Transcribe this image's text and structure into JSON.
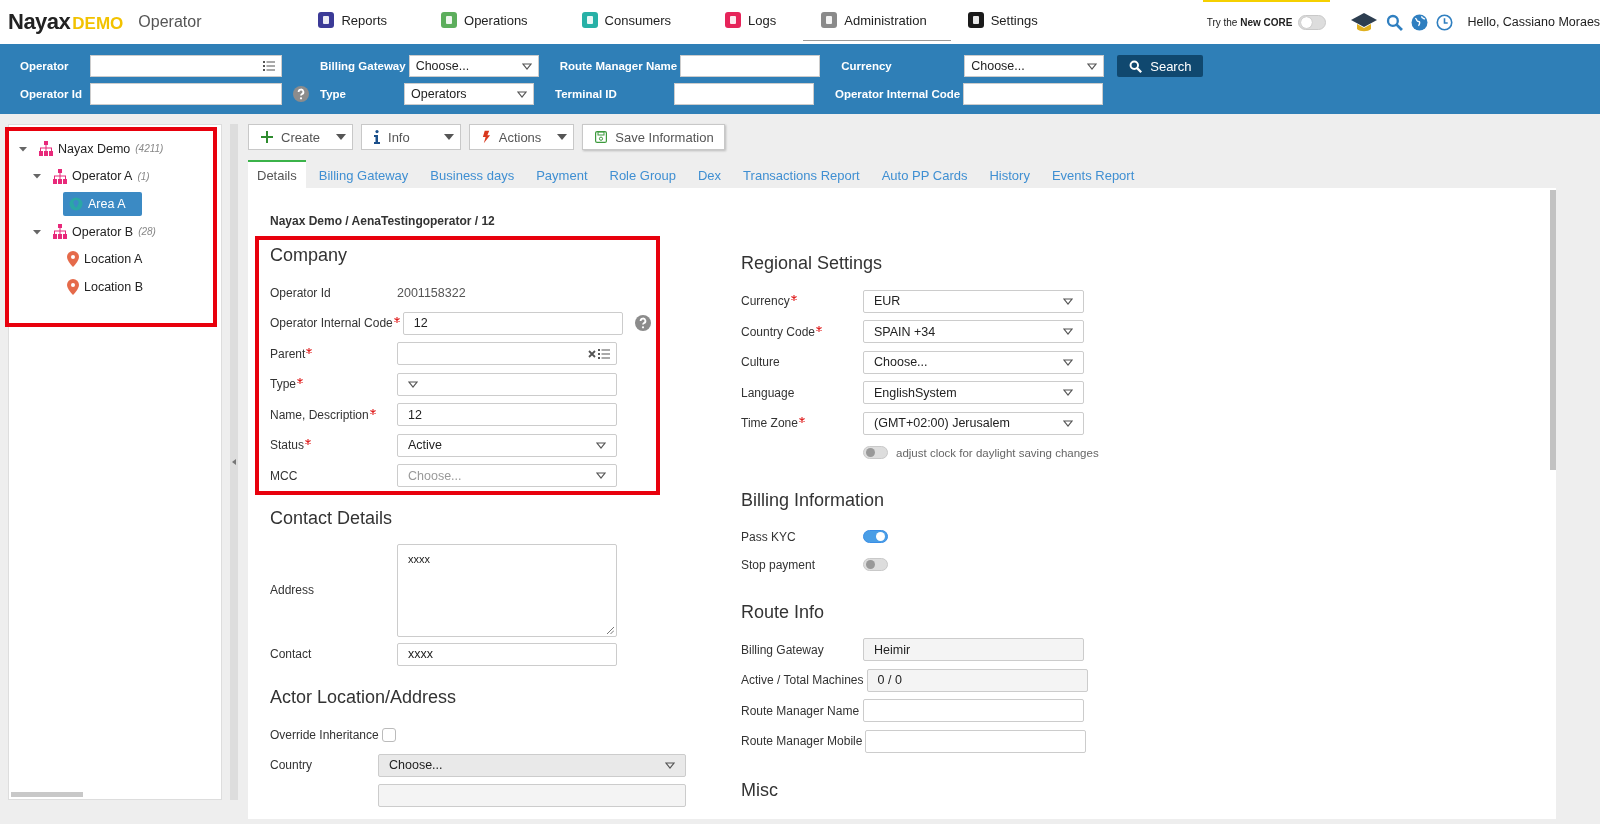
{
  "header": {
    "logo": {
      "name": "Nayax",
      "edition": "DEMO"
    },
    "page_title": "Operator",
    "nav": [
      {
        "label": "Reports",
        "selected": false
      },
      {
        "label": "Operations",
        "selected": false
      },
      {
        "label": "Consumers",
        "selected": false
      },
      {
        "label": "Logs",
        "selected": false
      },
      {
        "label": "Administration",
        "selected": true
      },
      {
        "label": "Settings",
        "selected": false
      }
    ],
    "core_switch": {
      "label": "Try the **New CORE**",
      "on": false
    },
    "greeting": "Hello, Cassiano Moraes"
  },
  "filters": {
    "rows": [
      [
        {
          "label": "Operator",
          "kind": "list",
          "help": false
        },
        {
          "label": "Billing Gateway",
          "kind": "select",
          "value": "Choose...",
          "help": false
        },
        {
          "label": "Route Manager Name",
          "kind": "text",
          "help": false
        },
        {
          "label": "Currency",
          "kind": "select",
          "value": "Choose...",
          "help": false
        }
      ],
      [
        {
          "label": "Operator Id",
          "kind": "text",
          "help": true
        },
        {
          "label": "Type",
          "kind": "select",
          "value": "Operators",
          "help": false
        },
        {
          "label": "Terminal ID",
          "kind": "text",
          "help": false
        },
        {
          "label": "Operator Internal Code",
          "kind": "text",
          "help": false
        }
      ]
    ],
    "search_button": "Search"
  },
  "tree": {
    "highlighted": true,
    "nodes": [
      {
        "label": "Nayax Demo",
        "count": "(4211)",
        "kind": "operator",
        "expanded": true,
        "selected": false,
        "children": [
          {
            "label": "Operator A",
            "count": "(1)",
            "kind": "operator",
            "expanded": true,
            "selected": false,
            "children": [
              {
                "label": "Area A",
                "kind": "area",
                "selected": true
              }
            ]
          },
          {
            "label": "Operator B",
            "count": "(28)",
            "kind": "operator",
            "expanded": true,
            "selected": false,
            "children": [
              {
                "label": "Location A",
                "kind": "location",
                "selected": false
              },
              {
                "label": "Location B",
                "kind": "location",
                "selected": false
              }
            ]
          }
        ]
      }
    ]
  },
  "toolbar": [
    {
      "label": "Create",
      "dropdown": true
    },
    {
      "label": "Info",
      "dropdown": true
    },
    {
      "label": "Actions",
      "dropdown": true
    },
    {
      "label": "Save Information",
      "dropdown": false
    }
  ],
  "tabs": [
    {
      "label": "Details",
      "selected": true
    },
    {
      "label": "Billing Gateway",
      "selected": false
    },
    {
      "label": "Business days",
      "selected": false
    },
    {
      "label": "Payment",
      "selected": false
    },
    {
      "label": "Role Group",
      "selected": false
    },
    {
      "label": "Dex",
      "selected": false
    },
    {
      "label": "Transactions Report",
      "selected": false
    },
    {
      "label": "Auto PP Cards",
      "selected": false
    },
    {
      "label": "History",
      "selected": false
    },
    {
      "label": "Events Report",
      "selected": false
    }
  ],
  "breadcrumb": "Nayax Demo / AenaTestingoperator / 12",
  "columns": [
    {
      "sections": [
        {
          "title": "Company",
          "highlighted": true,
          "fields": [
            {
              "label": "Operator Id",
              "kind": "static",
              "value": "2001158322",
              "required": false,
              "help": false
            },
            {
              "label": "Operator Internal Code",
              "kind": "text",
              "value": "12",
              "required": true,
              "help": true
            },
            {
              "label": "Parent",
              "kind": "list",
              "required": true,
              "help": false
            },
            {
              "label": "Type",
              "kind": "select",
              "required": true,
              "help": false,
              "disabled": false
            },
            {
              "label": "Name, Description",
              "kind": "text",
              "value": "12",
              "required": true,
              "help": false
            },
            {
              "label": "Status",
              "kind": "select",
              "value": "Active",
              "required": true,
              "help": false,
              "disabled": false
            },
            {
              "label": "MCC",
              "kind": "select",
              "placeholder": "Choose...",
              "required": false,
              "help": false,
              "disabled": false
            }
          ]
        },
        {
          "title": "Contact Details",
          "highlighted": false,
          "fields": [
            {
              "label": "Address",
              "kind": "textarea",
              "value": "xxxx",
              "required": false,
              "help": false
            },
            {
              "label": "Contact",
              "kind": "text",
              "value": "xxxx",
              "required": false,
              "help": false
            }
          ]
        },
        {
          "title": "Actor Location/Address",
          "highlighted": false,
          "fields": [
            {
              "label": "Override Inheritance",
              "kind": "checkbox",
              "checked": false,
              "required": false,
              "help": false
            },
            {
              "label": "Country",
              "kind": "select",
              "value": "Choose...",
              "required": false,
              "help": false,
              "disabled": true
            },
            {
              "kind": "readonly"
            }
          ]
        }
      ]
    },
    {
      "sections": [
        {
          "title": "Regional Settings",
          "highlighted": false,
          "fields": [
            {
              "label": "Currency",
              "kind": "select",
              "value": "EUR",
              "required": true,
              "help": false,
              "disabled": false
            },
            {
              "label": "Country Code",
              "kind": "select",
              "value": "SPAIN +34",
              "required": true,
              "help": false,
              "disabled": false
            },
            {
              "label": "Culture",
              "kind": "select",
              "value": "Choose...",
              "required": false,
              "help": false,
              "disabled": false
            },
            {
              "label": "Language",
              "kind": "select",
              "value": "EnglishSystem",
              "required": false,
              "help": false,
              "disabled": false
            },
            {
              "label": "Time Zone",
              "kind": "select",
              "value": "(GMT+02:00) Jerusalem",
              "required": true,
              "help": false,
              "disabled": false
            },
            {
              "kind": "toggle",
              "on": false,
              "note": "adjust clock for daylight saving changes",
              "required": false,
              "help": false
            }
          ]
        },
        {
          "title": "Billing Information",
          "highlighted": false,
          "fields": [
            {
              "label": "Pass KYC",
              "kind": "toggle",
              "on": true,
              "required": false,
              "help": false
            },
            {
              "label": "Stop payment",
              "kind": "toggle",
              "on": false,
              "required": false,
              "help": false
            }
          ]
        },
        {
          "title": "Route Info",
          "highlighted": false,
          "fields": [
            {
              "label": "Billing Gateway",
              "kind": "readonly",
              "value": "Heimir",
              "required": false,
              "help": false
            },
            {
              "label": "Active / Total Machines",
              "kind": "readonly",
              "value": "0 / 0",
              "required": false,
              "help": false
            },
            {
              "label": "Route Manager Name",
              "kind": "text",
              "required": false,
              "help": false
            },
            {
              "label": "Route Manager Mobile",
              "kind": "text",
              "required": false,
              "help": false
            }
          ]
        },
        {
          "title": "Misc",
          "highlighted": false
        }
      ]
    }
  ]
}
